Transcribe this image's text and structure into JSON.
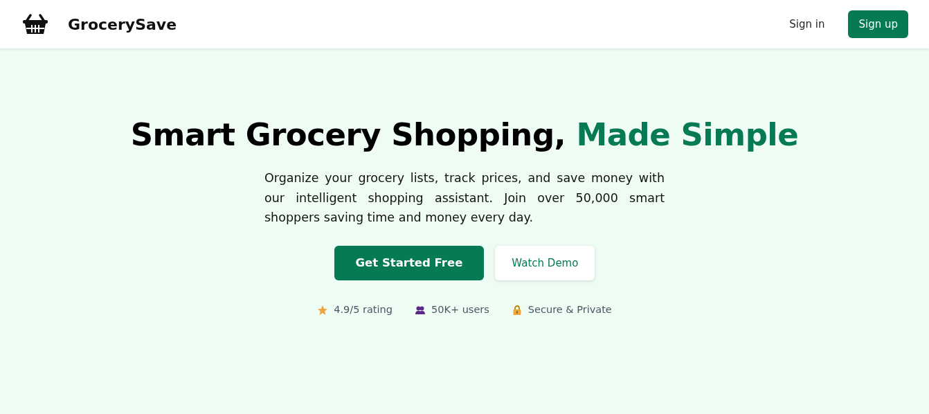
{
  "navbar": {
    "brand": "GrocerySave",
    "links": [
      {
        "label": "Sign in",
        "kind": "link"
      },
      {
        "label": "Sign up",
        "kind": "button"
      }
    ]
  },
  "hero": {
    "headline": "Smart Grocery Shopping,",
    "highlight": "Made Simple",
    "description": "Organize your grocery lists, track prices, and save money with our intelligent shopping assistant. Join over 50,000 smart shoppers saving time and money every day.",
    "buttons": [
      {
        "label": "Get Started Free",
        "kind": "primary"
      },
      {
        "label": "Watch Demo",
        "kind": "secondary"
      }
    ],
    "features": [
      {
        "kind": "star",
        "label": "4.9/5 rating"
      },
      {
        "kind": "users",
        "label": "50K+ users"
      },
      {
        "kind": "lock",
        "label": "Secure & Private"
      }
    ]
  }
}
